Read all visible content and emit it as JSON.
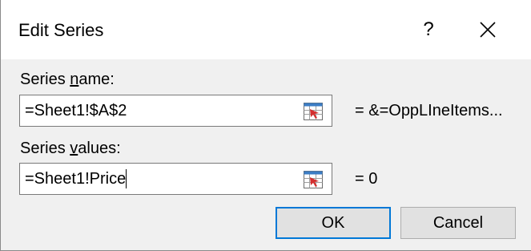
{
  "dialog": {
    "title": "Edit Series",
    "help_glyph": "?",
    "close_label": "Close"
  },
  "series_name": {
    "label_pre": "Series ",
    "label_accel": "n",
    "label_post": "ame:",
    "value": "=Sheet1!$A$2",
    "result": "= &=OppLIneItems..."
  },
  "series_values": {
    "label_pre": "Series ",
    "label_accel": "v",
    "label_post": "alues:",
    "value": "=Sheet1!Price",
    "result": "= 0"
  },
  "buttons": {
    "ok": "OK",
    "cancel": "Cancel"
  },
  "icons": {
    "close": "close-icon",
    "collapse_dialog": "collapse-dialog-icon"
  },
  "colors": {
    "default_button_border": "#0078d7",
    "dialog_background": "#f0f0f0"
  }
}
